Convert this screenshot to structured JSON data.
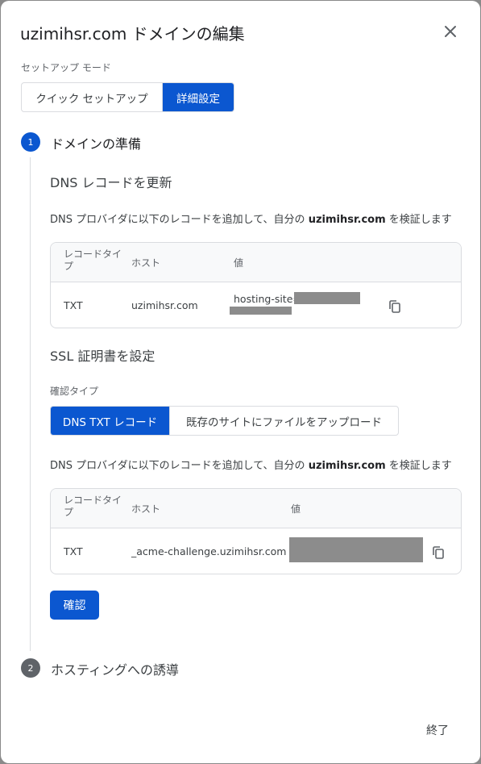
{
  "dialog": {
    "title": "uzimihsr.com ドメインの編集",
    "close_icon": "close-icon"
  },
  "mode": {
    "label": "セットアップ モード",
    "options": [
      "クイック セットアップ",
      "詳細設定"
    ],
    "selected": "詳細設定"
  },
  "step1": {
    "number": "1",
    "title": "ドメインの準備",
    "dns": {
      "heading": "DNS レコードを更新",
      "desc_prefix": "DNS プロバイダに以下のレコードを追加して、自分の ",
      "desc_domain": "uzimihsr.com",
      "desc_suffix": " を検証します",
      "columns": [
        "レコードタイプ",
        "ホスト",
        "値"
      ],
      "row": {
        "type": "TXT",
        "host": "uzimihsr.com",
        "value": "hosting-site="
      }
    },
    "ssl": {
      "heading": "SSL 証明書を設定",
      "confirm_type_label": "確認タイプ",
      "options": [
        "DNS TXT レコード",
        "既存のサイトにファイルをアップロード"
      ],
      "selected": "DNS TXT レコード",
      "desc_prefix": "DNS プロバイダに以下のレコードを追加して、自分の ",
      "desc_domain": "uzimihsr.com",
      "desc_suffix": " を検証します",
      "columns": [
        "レコードタイプ",
        "ホスト",
        "値"
      ],
      "row": {
        "type": "TXT",
        "host": "_acme-challenge.uzimihsr.com",
        "value": ""
      }
    },
    "confirm_button": "確認"
  },
  "step2": {
    "number": "2",
    "title": "ホスティングへの誘導"
  },
  "footer": {
    "finish_button": "終了"
  },
  "colors": {
    "primary": "#0b57d0",
    "step_inactive": "#5f6368",
    "redaction": "#8c8c8c"
  }
}
